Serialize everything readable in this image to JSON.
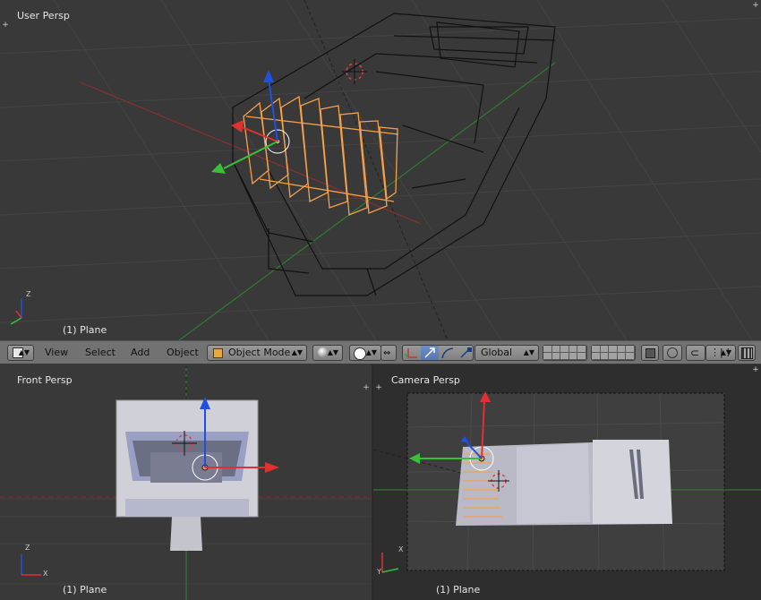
{
  "viewports": {
    "user": {
      "title": "User Persp",
      "object": "(1) Plane"
    },
    "front": {
      "title": "Front Persp",
      "object": "(1) Plane"
    },
    "camera": {
      "title": "Camera Persp",
      "object": "(1) Plane"
    }
  },
  "header": {
    "menus": {
      "view": "View",
      "select": "Select",
      "add": "Add",
      "object": "Object"
    },
    "mode": "Object Mode",
    "orientation": "Global"
  },
  "axes": {
    "x": "X",
    "y": "Y",
    "z": "Z"
  },
  "colors": {
    "selected": "#f5a04a",
    "x_axis": "#e03030",
    "y_axis": "#38c038",
    "z_axis": "#2050e0",
    "viewport_bg": "#393939",
    "header_bg": "#727272"
  },
  "icons": [
    "viewport-type-icon",
    "viewport-shading-icon",
    "pivot-icon",
    "manipulator-icon",
    "translate-icon",
    "rotate-icon",
    "scale-icon",
    "layers-icon",
    "lock-icon",
    "snap-icon",
    "proportional-icon",
    "render-icon"
  ]
}
